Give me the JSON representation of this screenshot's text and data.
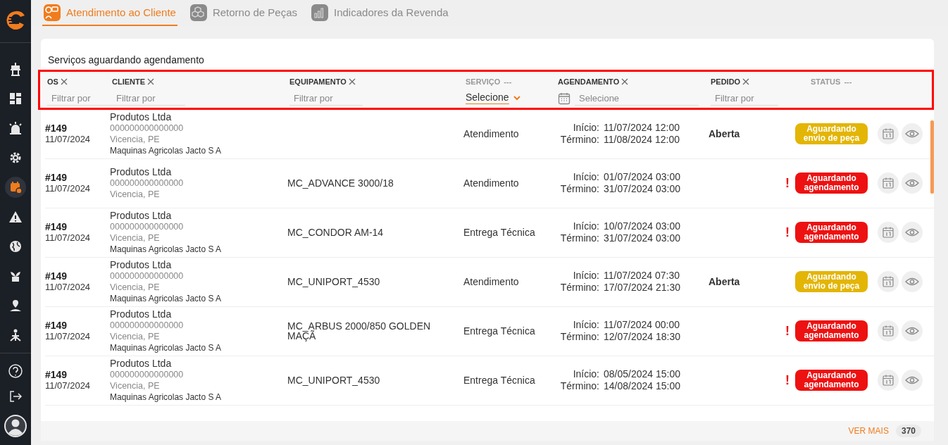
{
  "sidebar": {
    "items": [
      {
        "selected": false
      },
      {
        "selected": false
      },
      {
        "selected": false
      },
      {
        "selected": false
      },
      {
        "selected": true
      },
      {
        "selected": false
      },
      {
        "selected": false
      },
      {
        "selected": false
      },
      {
        "selected": false
      },
      {
        "selected": false
      }
    ]
  },
  "tabs": [
    {
      "label": "Atendimento ao Cliente",
      "selected": true
    },
    {
      "label": "Retorno de Peças",
      "selected": false
    },
    {
      "label": "Indicadores da Revenda",
      "selected": false
    }
  ],
  "card": {
    "title": "Serviços aguardando agendamento",
    "columns": [
      {
        "label": "OS",
        "kind": "clear",
        "filter": {
          "kind": "text",
          "placeholder": "Filtrar por"
        }
      },
      {
        "label": "CLIENTE",
        "kind": "clear",
        "filter": {
          "kind": "text",
          "placeholder": "Filtrar por"
        }
      },
      {
        "label": "EQUIPAMENTO",
        "kind": "clear",
        "filter": {
          "kind": "text",
          "placeholder": "Filtrar por"
        }
      },
      {
        "label": "SERVIÇO",
        "kind": "menu",
        "suffix": "---",
        "filter": {
          "kind": "select",
          "value": "Selecione"
        }
      },
      {
        "label": "AGENDAMENTO",
        "kind": "clear",
        "filter": {
          "kind": "date",
          "placeholder": "Selecione"
        }
      },
      {
        "label": "PEDIDO",
        "kind": "clear",
        "filter": {
          "kind": "text",
          "placeholder": "Filtrar por"
        }
      },
      {
        "label": "STATUS",
        "kind": "menu",
        "suffix": "---"
      }
    ],
    "rows": [
      {
        "os": "#149",
        "date": "11/07/2024",
        "client": {
          "name": "Produtos Ltda",
          "doc": "000000000000000",
          "city": "Vicencia, PE",
          "dealer": "Maquinas Agricolas Jacto S A"
        },
        "service": "Atendimento",
        "start_label": "Início:",
        "start": "11/07/2024 12:00",
        "end_label": "Término:",
        "end": "11/08/2024 12:00",
        "order": "Aberta",
        "status": {
          "text": "Aguardando envio de peça",
          "kind": "parts"
        }
      },
      {
        "os": "#149",
        "date": "11/07/2024",
        "client": {
          "name": "Produtos Ltda",
          "doc": "000000000000000",
          "city": "Vicencia, PE"
        },
        "equipment": "MC_ADVANCE 3000/18",
        "service": "Atendimento",
        "start_label": "Início:",
        "start": "01/07/2024 03:00",
        "end_label": "Término:",
        "end": "31/07/2024 03:00",
        "status": {
          "text": "Aguardando agendamento",
          "kind": "scheduling",
          "alert": "!"
        }
      },
      {
        "os": "#149",
        "date": "11/07/2024",
        "client": {
          "name": "Produtos Ltda",
          "doc": "000000000000000",
          "city": "Vicencia, PE",
          "dealer": "Maquinas Agricolas Jacto S A"
        },
        "equipment": "MC_CONDOR AM-14",
        "service": "Entrega Técnica",
        "start_label": "Início:",
        "start": "10/07/2024 03:00",
        "end_label": "Término:",
        "end": "31/07/2024 03:00",
        "status": {
          "text": "Aguardando agendamento",
          "kind": "scheduling",
          "alert": "!"
        }
      },
      {
        "os": "#149",
        "date": "11/07/2024",
        "client": {
          "name": "Produtos Ltda",
          "doc": "000000000000000",
          "city": "Vicencia, PE",
          "dealer": "Maquinas Agricolas Jacto S A"
        },
        "equipment": "MC_UNIPORT_4530",
        "service": "Atendimento",
        "start_label": "Início:",
        "start": "11/07/2024 07:30",
        "end_label": "Término:",
        "end": "17/07/2024 21:30",
        "order": "Aberta",
        "status": {
          "text": "Aguardando envio de peça",
          "kind": "parts"
        }
      },
      {
        "os": "#149",
        "date": "11/07/2024",
        "client": {
          "name": "Produtos Ltda",
          "doc": "000000000000000",
          "city": "Vicencia, PE",
          "dealer": "Maquinas Agricolas Jacto S A"
        },
        "equipment": "MC_ARBUS 2000/850 GOLDEN MAÇÃ",
        "service": "Entrega Técnica",
        "start_label": "Início:",
        "start": "11/07/2024 00:00",
        "end_label": "Término:",
        "end": "12/07/2024 18:30",
        "status": {
          "text": "Aguardando agendamento",
          "kind": "scheduling",
          "alert": "!"
        }
      },
      {
        "os": "#149",
        "date": "11/07/2024",
        "client": {
          "name": "Produtos Ltda",
          "doc": "000000000000000",
          "city": "Vicencia, PE",
          "dealer": "Maquinas Agricolas Jacto S A"
        },
        "equipment": "MC_UNIPORT_4530",
        "service": "Entrega Técnica",
        "start_label": "Início:",
        "start": "08/05/2024 15:00",
        "end_label": "Término:",
        "end": "14/08/2024 15:00",
        "status": {
          "text": "Aguardando agendamento",
          "kind": "scheduling",
          "alert": "!"
        }
      }
    ],
    "footer": {
      "link": "VER MAIS",
      "count": "370"
    }
  }
}
